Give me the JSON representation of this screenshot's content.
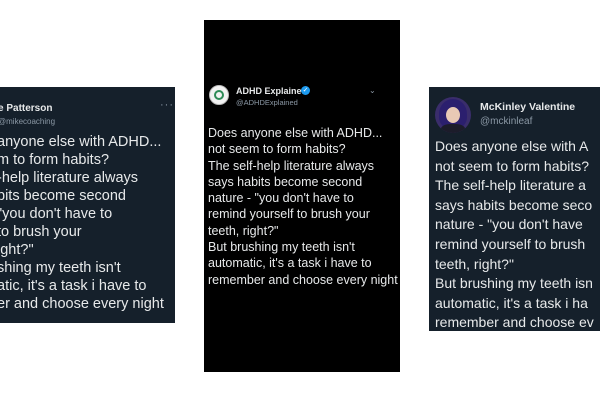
{
  "cards": [
    {
      "name": "e Patterson",
      "handle": "@mikecoaching",
      "lines": [
        "anyone else with ADHD...",
        "m to form habits?",
        "-help literature always",
        "bits become second",
        "\"you don't have to",
        "to brush your",
        "ight?\"",
        "shing my teeth isn't",
        "atic, it's a task i have to",
        "er and choose every night"
      ]
    },
    {
      "name": "ADHD Explained",
      "handle": "@ADHDExplained",
      "lines": [
        "Does anyone else with ADHD...",
        "not seem to form habits?",
        "The self-help literature always",
        "says habits become second",
        "nature - \"you don't have to",
        "remind yourself to brush your",
        "teeth, right?\"",
        "But brushing my teeth isn't",
        "automatic, it's a task i have to",
        "remember and choose every night"
      ]
    },
    {
      "name": "McKinley Valentine",
      "handle": "@mckinleaf",
      "lines": [
        "Does anyone else with A",
        "not seem to form habits?",
        "The self-help literature a",
        "says habits become seco",
        "nature - \"you don't have",
        "remind yourself to brush",
        "teeth, right?\"",
        "But brushing my teeth isn",
        "automatic, it's a task i ha",
        "remember and choose ev"
      ]
    }
  ]
}
